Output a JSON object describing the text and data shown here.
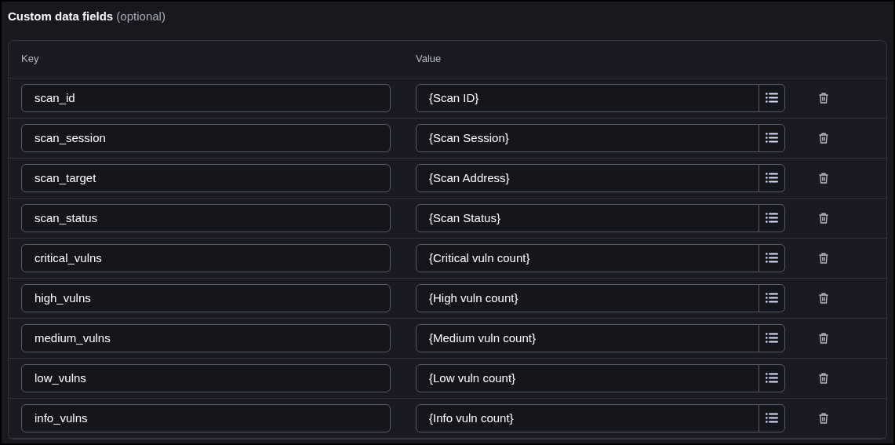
{
  "section": {
    "title": "Custom data fields",
    "note": "(optional)"
  },
  "columns": [
    "Key",
    "Value"
  ],
  "rows": [
    {
      "key": "scan_id",
      "value": "{Scan ID}"
    },
    {
      "key": "scan_session",
      "value": "{Scan Session}"
    },
    {
      "key": "scan_target",
      "value": "{Scan Address}"
    },
    {
      "key": "scan_status",
      "value": "{Scan Status}"
    },
    {
      "key": "critical_vulns",
      "value": "{Critical vuln count}"
    },
    {
      "key": "high_vulns",
      "value": "{High vuln count}"
    },
    {
      "key": "medium_vulns",
      "value": "{Medium vuln count}"
    },
    {
      "key": "low_vulns",
      "value": "{Low vuln count}"
    },
    {
      "key": "info_vulns",
      "value": "{Info vuln count}"
    }
  ]
}
